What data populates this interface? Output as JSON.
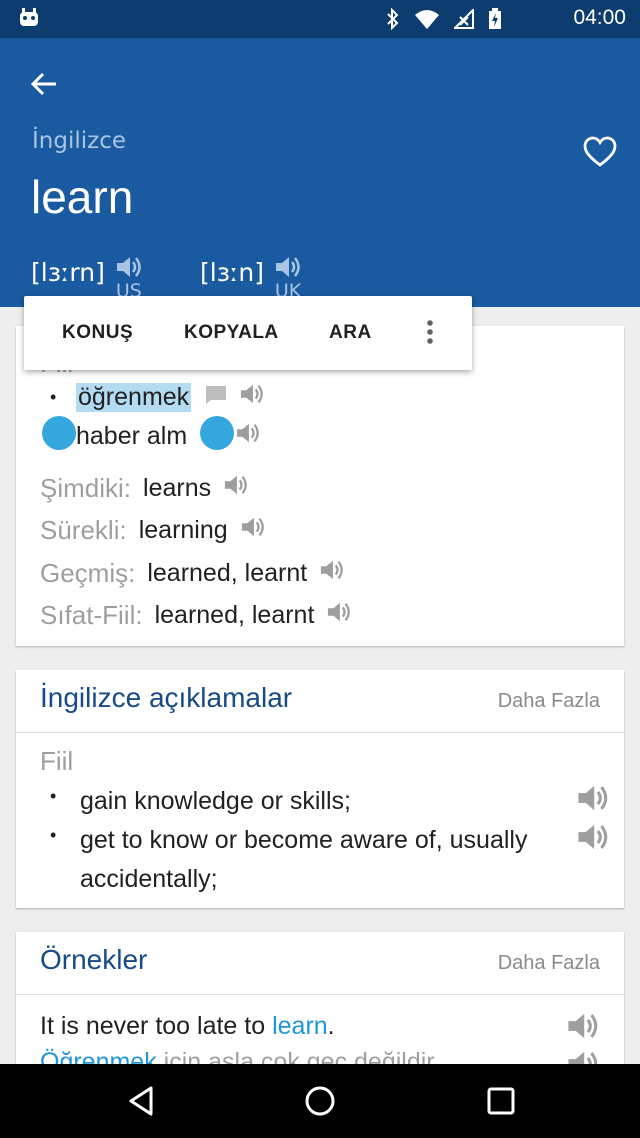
{
  "status_bar": {
    "time": "04:00"
  },
  "header": {
    "language": "İngilizce",
    "word": "learn",
    "pronunciations": [
      {
        "ipa": "[lɜːrn]",
        "region": "US"
      },
      {
        "ipa": "[lɜːn]",
        "region": "UK"
      }
    ]
  },
  "context_menu": {
    "items": [
      "KONUŞ",
      "KOPYALA",
      "ARA"
    ]
  },
  "translation_card": {
    "part_of_speech": "Fiil",
    "meanings": [
      "öğrenmek",
      "haber almak"
    ],
    "meaning_visible": [
      "öğrenmek",
      "haber alm"
    ],
    "forms": [
      {
        "label": "Şimdiki:",
        "value": "learns"
      },
      {
        "label": "Sürekli:",
        "value": "learning"
      },
      {
        "label": "Geçmiş:",
        "value": "learned, learnt"
      },
      {
        "label": "Sıfat-Fiil:",
        "value": "learned, learnt"
      }
    ]
  },
  "definitions_card": {
    "title": "İngilizce açıklamalar",
    "more": "Daha Fazla",
    "part_of_speech": "Fiil",
    "definitions": [
      "gain knowledge or skills;",
      "get to know or become aware of, usually accidentally;"
    ]
  },
  "examples_card": {
    "title": "Örnekler",
    "more": "Daha Fazla",
    "example_en_before": "It is never too late to ",
    "example_en_highlight": "learn",
    "example_en_after": ".",
    "example_tr_highlight": "Öğrenmek",
    "example_tr_rest": " için asla çok geç değildir."
  },
  "colors": {
    "status_bar": "#0d3d6e",
    "app_bar": "#1a5aa0",
    "title_blue": "#174a87",
    "highlight_blue": "#2196d6",
    "selection": "#b3dcf2",
    "handle": "#35a7df"
  }
}
